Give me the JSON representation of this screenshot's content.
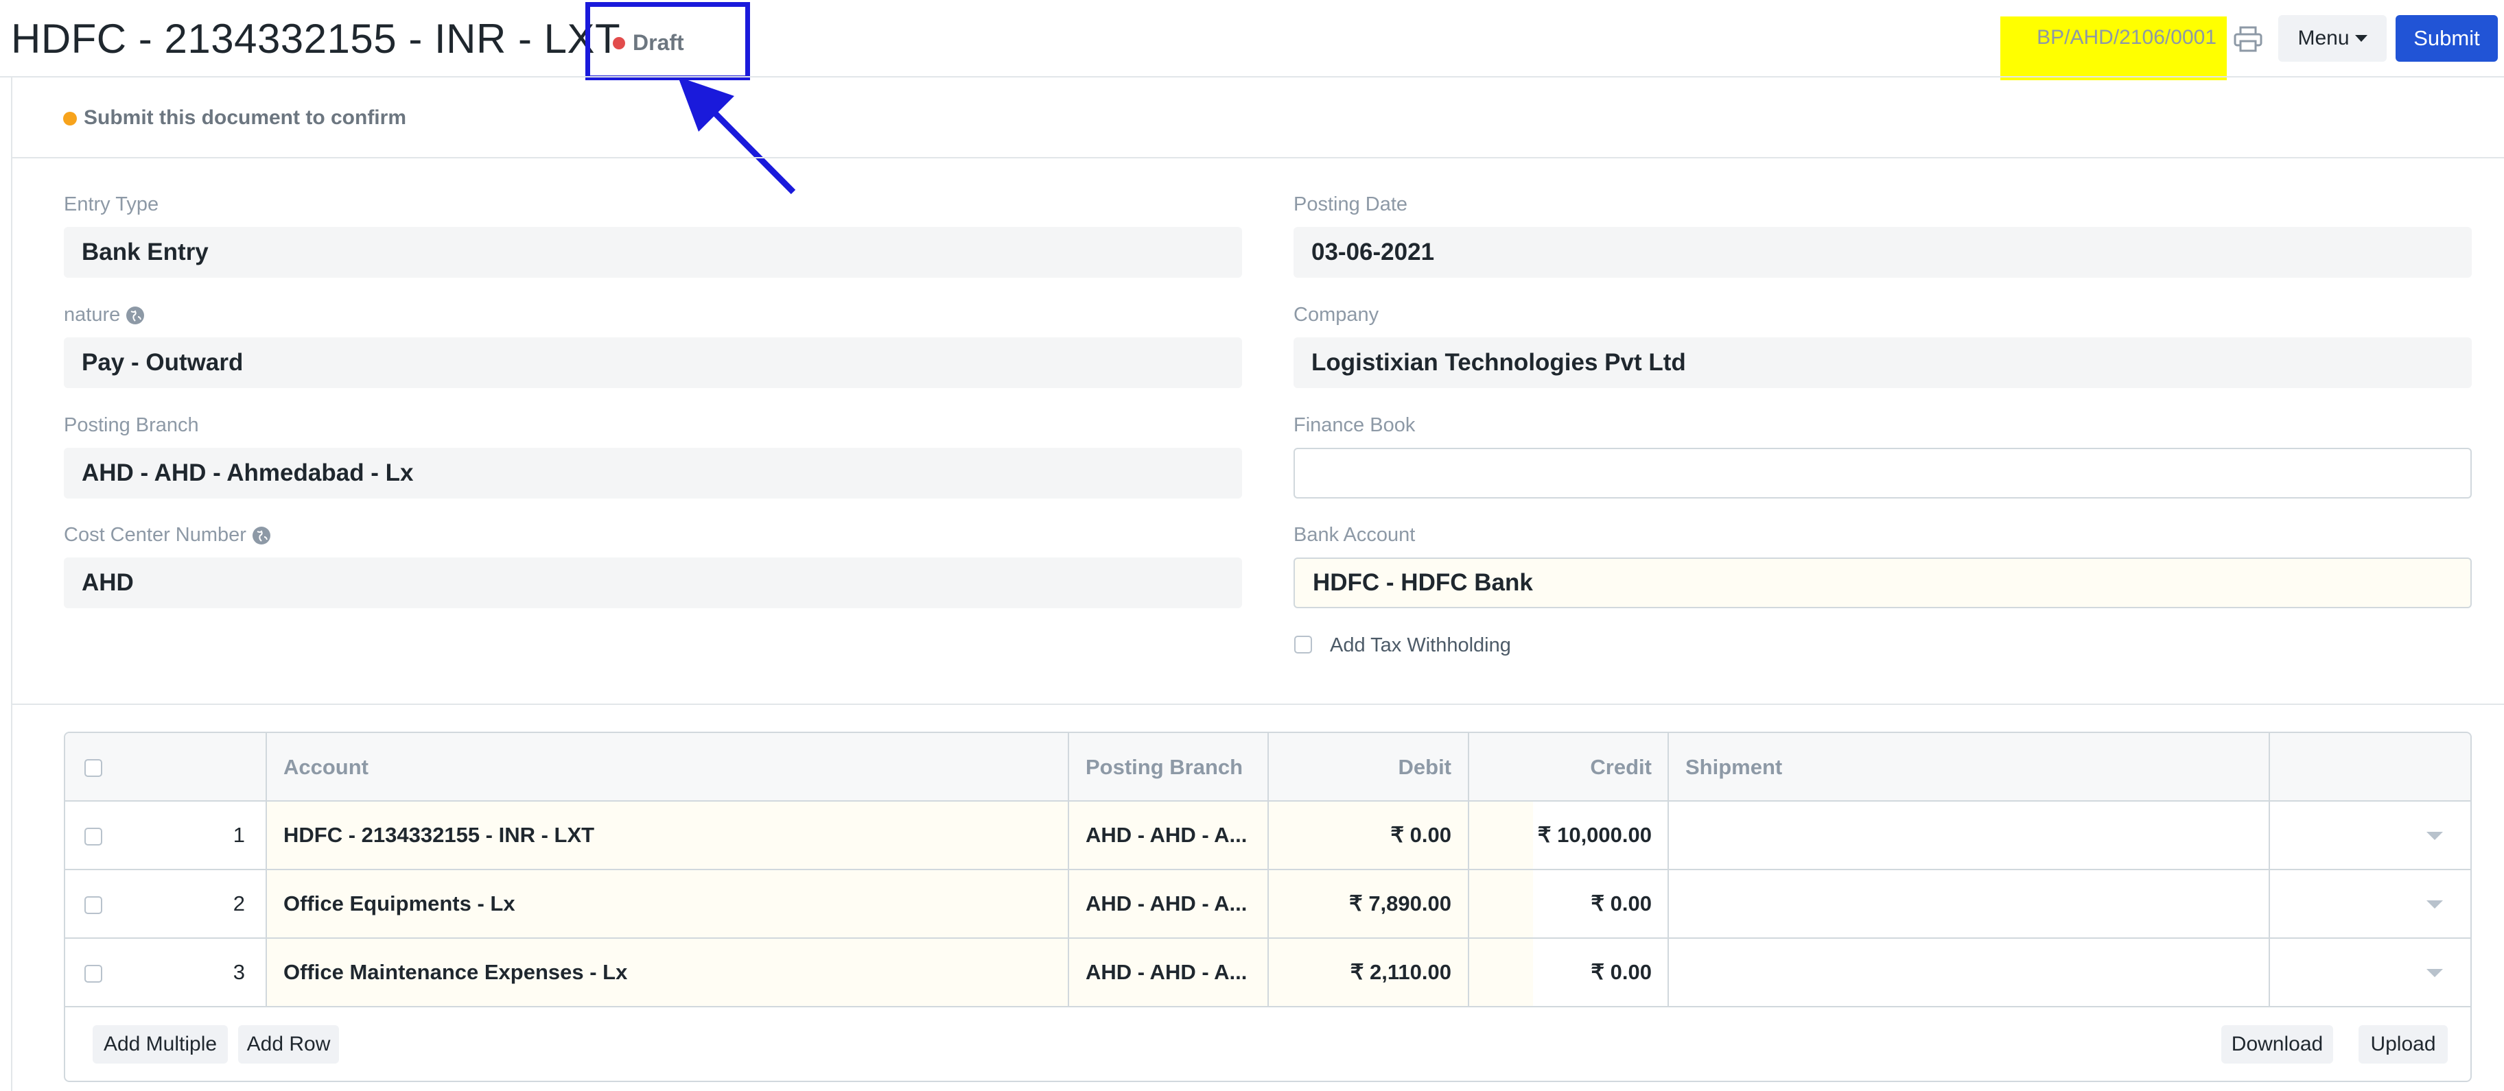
{
  "header": {
    "title": "HDFC - 2134332155 - INR - LXT",
    "status": "Draft",
    "doc_name": "BP/AHD/2106/0001",
    "menu_label": "Menu",
    "submit_label": "Submit",
    "print_icon": "printer-icon"
  },
  "notice": {
    "text": "Submit this document to confirm"
  },
  "form": {
    "left": [
      {
        "label": "Entry Type",
        "value": "Bank Entry"
      },
      {
        "label": "nature",
        "value": "Pay - Outward"
      },
      {
        "label": "Posting Branch",
        "value": "AHD - AHD - Ahmedabad - Lx"
      },
      {
        "label": "Cost Center Number",
        "value": "AHD"
      }
    ],
    "right": [
      {
        "label": "Posting Date",
        "value": "03-06-2021"
      },
      {
        "label": "Company",
        "value": "Logistixian Technologies Pvt Ltd"
      },
      {
        "label": "Finance Book",
        "value": ""
      },
      {
        "label": "Bank Account",
        "value": "HDFC - HDFC Bank"
      }
    ],
    "tax_checkbox_label": "Add Tax Withholding"
  },
  "table": {
    "columns": [
      "Account",
      "Posting Branch",
      "Debit",
      "Credit",
      "Shipment"
    ],
    "rows": [
      {
        "no": "1",
        "account": "HDFC - 2134332155 - INR - LXT",
        "branch": "AHD - AHD - A...",
        "debit": "₹ 0.00",
        "credit": "₹ 10,000.00",
        "shipment": ""
      },
      {
        "no": "2",
        "account": "Office Equipments - Lx",
        "branch": "AHD - AHD - A...",
        "debit": "₹ 7,890.00",
        "credit": "₹ 0.00",
        "shipment": ""
      },
      {
        "no": "3",
        "account": "Office Maintenance Expenses - Lx",
        "branch": "AHD - AHD - A...",
        "debit": "₹ 2,110.00",
        "credit": "₹ 0.00",
        "shipment": ""
      }
    ],
    "buttons": {
      "add_multiple": "Add Multiple",
      "add_row": "Add Row",
      "download": "Download",
      "upload": "Upload"
    }
  },
  "colors": {
    "accent": "#2154d6",
    "draft": "#e24c4c",
    "notice": "#f7a31c",
    "annotation": "#1a1adb",
    "highlight": "#ffff00"
  }
}
